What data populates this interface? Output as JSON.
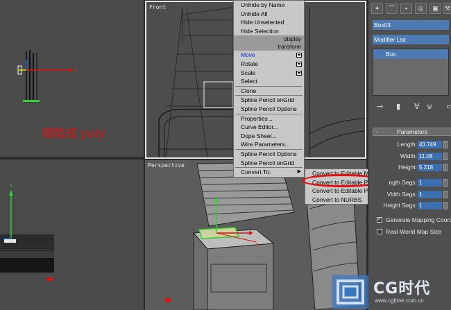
{
  "viewports": {
    "top": {
      "label": ""
    },
    "front": {
      "label": "Front"
    },
    "left": {
      "label": ""
    },
    "perspective": {
      "label": "Perspective"
    }
  },
  "annotation_text": "塌陷成 poly",
  "quad_menu": {
    "display_items": [
      "Unhide by Name",
      "Unhide All",
      "Hide Unselected",
      "Hide Selection"
    ],
    "display_header": "display",
    "transform_header": "transform",
    "transform_items": [
      {
        "label": "Move",
        "has_box": true,
        "highlighted": true
      },
      {
        "label": "Rotate",
        "has_box": true
      },
      {
        "label": "Scale",
        "has_box": true
      },
      {
        "label": "Select",
        "has_box": false
      }
    ],
    "clone_label": "Clone",
    "spline_items": [
      "Spline Pencil onGrid",
      "Spline Pencil Options"
    ],
    "edit_items": [
      "Properties...",
      "Curve Editor...",
      "Dope Sheet...",
      "Wire Parameters..."
    ],
    "spline_items_2": [
      "Spline Pencil Options",
      "Spline Pencil onGrid"
    ],
    "convert_label": "Convert To:"
  },
  "convert_submenu": [
    "Convert to Editable Mesh",
    "Convert to Editable Poly",
    "Convert to Editable Patch",
    "Convert to NURBS"
  ],
  "command_panel": {
    "object_name": "Box03",
    "modifier_list_label": "Modifier List",
    "stack_items": [
      "Box"
    ],
    "rollout_title": "Parameters",
    "params": [
      {
        "label": "Length:",
        "value": "43.749"
      },
      {
        "label": "Width:",
        "value": "11.08"
      },
      {
        "label": "Height:",
        "value": "5.218"
      },
      {
        "label": "ngth Segs:",
        "value": "1"
      },
      {
        "label": "Vidth Segs:",
        "value": "1"
      },
      {
        "label": "Height Segs:",
        "value": "1"
      }
    ],
    "checkboxes": [
      {
        "label": "Generate Mapping Coord",
        "checked": true
      },
      {
        "label": "Real-World Map Size",
        "checked": false
      }
    ]
  },
  "watermark": {
    "logo": "CG时代",
    "url": "www.cgtime.com.cn"
  },
  "colors": {
    "highlight_oval": "#e51010",
    "selection_blue": "#4e7ab3",
    "menu_bg": "#c8c8c8"
  }
}
